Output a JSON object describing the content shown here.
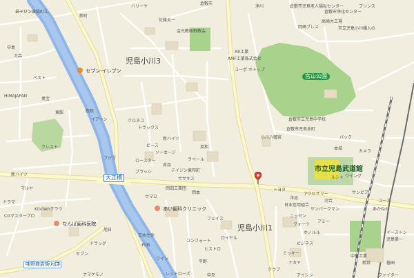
{
  "map": {
    "areas": [
      "児島小川3",
      "児島小川1"
    ],
    "bridge_label": "大正橋",
    "park_label": "宮山公園",
    "dojo_label": "市立児島武道館",
    "junction_label": "味野商店街入口",
    "pois": {
      "seven": "セブン-イレブン",
      "dental1": "なんば歯科医院",
      "dental2": "あい歯科クリニック"
    },
    "labels": [
      "テイジン東陽町工",
      "新町",
      "ハリーヤ",
      "倉敷市児島老人福祉センター",
      "倉敷市浄化センター",
      "倉敷市",
      "岡崎プレス",
      "市立児島小川横入の",
      "金光教味野教会",
      "AR工業",
      "AMF工業株式会社",
      "コーポ ホトップ",
      "佐藤太一",
      "小川八幡宮",
      "倉敷市立児島中学校",
      "倉敷市児島本町",
      "浄川",
      "高崎大工場",
      "ブリンス",
      "中島",
      "大森",
      "ペスト",
      "奥宝",
      "東館",
      "西館",
      "イアーン",
      "クロネコ",
      "トラックス",
      "新ハイツ",
      "ピース",
      "ソーセージ",
      "ロースター",
      "食品",
      "ラベール",
      "英和",
      "テイジン東邦町",
      "ササキス",
      "岡本",
      "ウマロ",
      "岡田工業団",
      "フジゴ",
      "ブラッシ",
      "クレスト",
      "Kitchenクラウ",
      "HIMAJAPAN",
      "ドラマ",
      "CGマスタープロ",
      "マルヤ",
      "新ハイツ",
      "ハイネ",
      "セブン",
      "ドラッグ",
      "ナマケモノ",
      "旭日",
      "日本生命",
      "石油",
      "ワイン",
      "レッドローズ",
      "フェイス",
      "ロイヤル",
      "コンフォート",
      "ヒストロ",
      "平野",
      "中央",
      "トヨタ",
      "洋品",
      "アクセサリー",
      "日本信用組合",
      "ニッセン",
      "クォーツ",
      "ホノルル",
      "ビジネス",
      "ミッキー",
      "ナカヤ",
      "クラブ",
      "アイシン",
      "コース",
      "あかねや",
      "イーストン",
      "児島第一",
      "中島工業",
      "新井",
      "植田",
      "ファイター",
      "ウイング",
      "カメラ",
      "本城",
      "パック",
      "ルシャ",
      "サンピア",
      "河合",
      "サンパークマン",
      "アミー",
      "ローソン"
    ]
  }
}
